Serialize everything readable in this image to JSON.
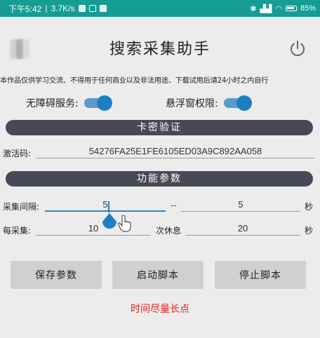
{
  "status_bar": {
    "time": "下午5:42",
    "network_speed": "3.7K/s",
    "battery": "85%"
  },
  "header": {
    "title": "搜索采集助手"
  },
  "notice": "本作品仅供学习交流、不得用于任何商业以及非法用途、下载试用后请24小时之内自行",
  "toggles": [
    {
      "label": "无障碍服务:",
      "on": true
    },
    {
      "label": "悬浮窗权限:",
      "on": true
    }
  ],
  "sections": {
    "card_verify": "卡密验证",
    "function_params": "功能参数"
  },
  "activation": {
    "label": "激活码:",
    "value": "54276FA25E1FE6105ED03A9C892AA058"
  },
  "interval": {
    "label": "采集间隔:",
    "min": "5",
    "separator": "--",
    "max": "5",
    "unit": "秒"
  },
  "batch": {
    "label": "每采集:",
    "count": "10",
    "rest_label": "次休息",
    "rest_value": "20",
    "unit": "秒"
  },
  "buttons": {
    "save": "保存参数",
    "start": "启动脚本",
    "stop": "停止脚本"
  },
  "red_note": "时间尽量长点",
  "colors": {
    "status_bar": "#159d94",
    "accent": "#1a7fc4",
    "section_bar": "#474a55",
    "note": "#e02020"
  }
}
